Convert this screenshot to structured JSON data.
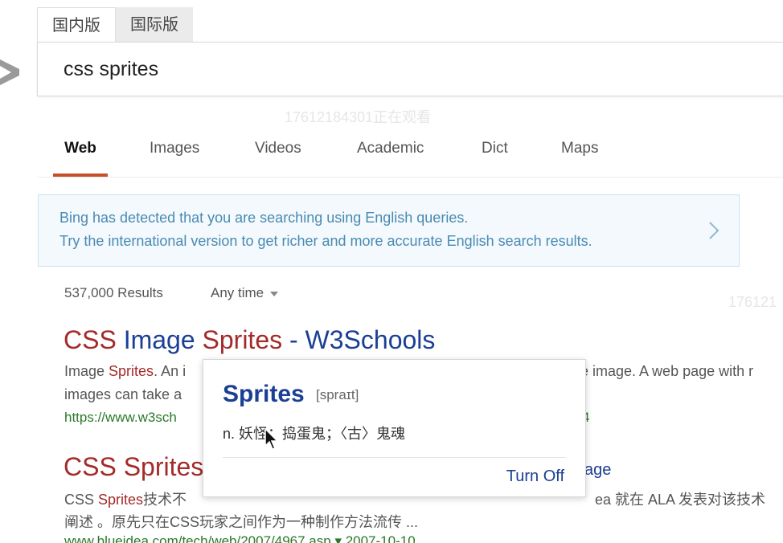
{
  "region_tabs": [
    "国内版",
    "国际版"
  ],
  "search": {
    "query": "css sprites"
  },
  "watermark": {
    "text1": "17612184301正在观看",
    "text2": "176121"
  },
  "nav": {
    "items": [
      "Web",
      "Images",
      "Videos",
      "Academic",
      "Dict",
      "Maps"
    ],
    "active": "Web"
  },
  "banner": {
    "line1": "Bing has detected that you are searching using English queries.",
    "line2": "Try the international version to get richer and more accurate English search results."
  },
  "results_meta": {
    "count": "537,000 Results",
    "time_filter": "Any time"
  },
  "results": [
    {
      "title_part1": "CSS ",
      "title_part2": "Image ",
      "title_part3": "Sprites",
      "title_part4": " - W3Schools",
      "snippet_a": "Image ",
      "snippet_b": "Sprites",
      "snippet_c": ". An i",
      "snippet_right": "le image. A web page with r",
      "snippet_line2": "images can take a",
      "url": "https://www.w3sch",
      "url_tail": "4"
    },
    {
      "title_part1": "CSS Sprites",
      "title_tail": "age",
      "snippet_a": "CSS ",
      "snippet_b": "Sprites",
      "snippet_c": "技术不",
      "snippet_right": "ea 就在 ALA 发表对该技术",
      "snippet_line2": "阐述 。原先只在CSS玩家之间作为一种制作方法流传 ...",
      "url": "www.blueidea.com/tech/web/2007/4967.asp  ▾   2007-10-10"
    }
  ],
  "dictionary_popup": {
    "word": "Sprites",
    "phonetic": "[spraɪt]",
    "definition": "n.  妖怪；捣蛋鬼；〈古〉鬼魂",
    "turn_off": "Turn Off"
  },
  "colors": {
    "title_highlight": "#a52a2a",
    "title_link": "#1b3f94",
    "url_green": "#2a7a2a",
    "tab_underline": "#c7502a"
  }
}
